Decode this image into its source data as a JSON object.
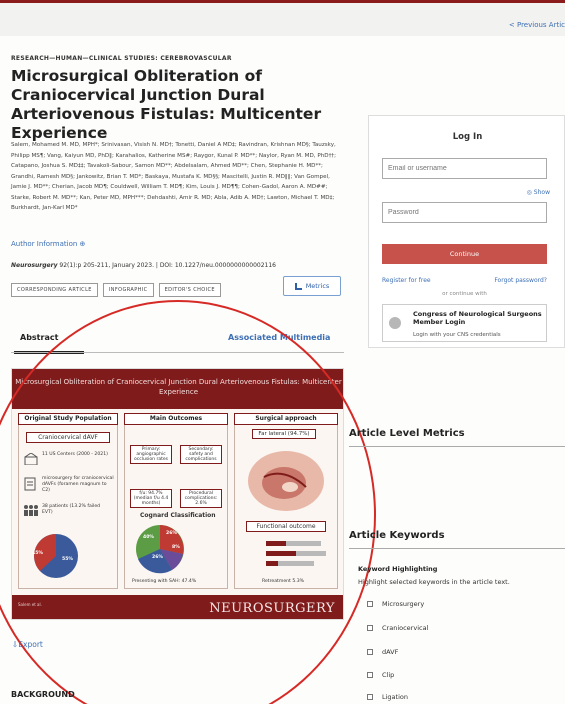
{
  "nav": {
    "previous_label": "< Previous Artic"
  },
  "article": {
    "kicker": "RESEARCH—HUMAN—CLINICAL STUDIES: CEREBROVASCULAR",
    "title": "Microsurgical Obliteration of Craniocervical Junction Dural Arteriovenous Fistulas: Multicenter Experience",
    "authors": "Salem, Mohamed M. MD, MPH*; Srinivasan, Visish N. MD†; Tonetti, Daniel A MD‡; Ravindran, Krishnan MD§; Tauzsky, Philipp MS¶; Vang, Kaiyun MD, PhD‖; Karahalios, Katherine MS#; Raygor, Kunal P. MD**; Naylor, Ryan M. MD, PhD††; Catapano, Joshua S. MD‡‡; Tavakoli-Sabour, Samon MD**; Abdelsalam, Ahmed MD**; Chen, Stephanie H. MD**; Grandhi, Ramesh MD§; Jankowitz, Brian T. MD*; Baskaya, Mustafa K. MD§§; Mascitelli, Justin R. MD‖‖; Van Gompel, Jamie J. MD**; Cherian, Jacob MD¶; Couldwell, William T. MD¶; Kim, Louis J. MD¶¶; Cohen-Gadol, Aaron A. MD##; Starke, Robert M. MD**; Kan, Peter MD, MPH***; Dehdashti, Amir R. MD; Abla, Adib A. MD†; Lawton, Michael T. MD‡; Burkhardt, Jan-Karl MD*",
    "author_info_label": "Author Information",
    "journal": "Neurosurgery",
    "citation_rest": " 92(1):p 205-211, January 2023. | DOI: 10.1227/neu.0000000000002116",
    "badges": [
      "CORRESPONDING ARTICLE",
      "INFOGRAPHIC",
      "EDITOR'S CHOICE"
    ],
    "metrics_label": "Metrics"
  },
  "tabs": {
    "abstract": "Abstract",
    "multimedia": "Associated Multimedia"
  },
  "infographic": {
    "header": "Microsurgical Obliteration of Craniocervical Junction Dural Arteriovenous Fistulas: Multicenter Experience",
    "col1_title": "Original Study Population",
    "col1_sub": "Craniocervical dAVF",
    "col1_stat1": "11 US Centers (2000 - 2021)",
    "col1_stat2": "microsurgery for craniocervical dAVFs (foramen magnum to C2)",
    "col1_stat3": "38 patients (13.2% failed EVT)",
    "col1_pie_a": "45%",
    "col1_pie_b": "55%",
    "col2_title": "Main Outcomes",
    "col2_chip1": "Primary: angiographic occlusion rates",
    "col2_chip2": "Secondary: safety and complications",
    "col2_stat1": "f/u: 94.7% (median f/u 4.4 months)",
    "col2_stat2": "Procedural complications: 2.6%",
    "col2_sub": "Cognard Classification",
    "col2_pie_a": "40%",
    "col2_pie_b": "26%",
    "col2_pie_c": "8%",
    "col2_pie_d": "26%",
    "col2_foot": "Presenting with SAH: 47.4%",
    "col3_title": "Surgical approach",
    "col3_chip": "Far lateral (94.7%)",
    "col3_sub": "Functional outcome",
    "col3_foot": "Retreatment 5.3%",
    "brand": "NEUROSURGERY",
    "footer_note": "Salem et al.",
    "colors": {
      "maroon": "#7f1c1b",
      "blue": "#3a5a9c",
      "green": "#5b9c44",
      "purple": "#6b4c9a"
    }
  },
  "export_label": "Export",
  "background_heading": "BACKGROUND",
  "login": {
    "title": "Log In",
    "email_placeholder": "Email or username",
    "password_placeholder": "Password",
    "show_label": "Show",
    "continue_label": "Continue",
    "register_label": "Register for free",
    "forgot_label": "Forgot password?",
    "or_label": "or continue with",
    "cns_title": "Congress of Neurological Surgeons Member Login",
    "cns_sub": "Login with your CNS credentials"
  },
  "sidebar": {
    "metrics_heading": "Article Level Metrics",
    "keywords_heading": "Article Keywords",
    "highlight_label": "Keyword Highlighting",
    "highlight_desc": "Highlight selected keywords in the article text.",
    "keywords": [
      "Microsurgery",
      "Craniocervical",
      "dAVF",
      "Clip",
      "Ligation"
    ]
  }
}
